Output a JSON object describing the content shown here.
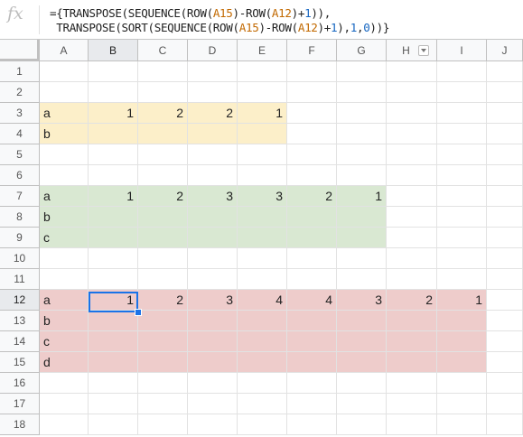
{
  "formula_bar": {
    "fx_label": "fx",
    "line1": [
      {
        "t": "={TRANSPOSE(SEQUENCE(ROW(",
        "c": "txt"
      },
      {
        "t": "A15",
        "c": "ref"
      },
      {
        "t": ")-ROW(",
        "c": "txt"
      },
      {
        "t": "A12",
        "c": "ref"
      },
      {
        "t": ")+",
        "c": "txt"
      },
      {
        "t": "1",
        "c": "num"
      },
      {
        "t": ")),",
        "c": "txt"
      }
    ],
    "line2": [
      {
        "t": " TRANSPOSE(SORT(SEQUENCE(ROW(",
        "c": "txt"
      },
      {
        "t": "A15",
        "c": "ref"
      },
      {
        "t": ")-ROW(",
        "c": "txt"
      },
      {
        "t": "A12",
        "c": "ref"
      },
      {
        "t": ")+",
        "c": "txt"
      },
      {
        "t": "1",
        "c": "num"
      },
      {
        "t": "),",
        "c": "txt"
      },
      {
        "t": "1",
        "c": "num"
      },
      {
        "t": ",",
        "c": "txt"
      },
      {
        "t": "0",
        "c": "num"
      },
      {
        "t": "))}",
        "c": "txt"
      }
    ]
  },
  "columns": [
    "A",
    "B",
    "C",
    "D",
    "E",
    "F",
    "G",
    "H",
    "I",
    "J"
  ],
  "rows": [
    "1",
    "2",
    "3",
    "4",
    "5",
    "6",
    "7",
    "8",
    "9",
    "10",
    "11",
    "12",
    "13",
    "14",
    "15",
    "16",
    "17",
    "18"
  ],
  "selected": {
    "column": "B",
    "row": "12"
  },
  "filter_column": "H",
  "fills": {
    "yellow": "#fcefc9",
    "green": "#d9e8d2",
    "red": "#eecccb"
  },
  "cells": {
    "A3": "a",
    "B3": "1",
    "C3": "2",
    "D3": "2",
    "E3": "1",
    "A4": "b",
    "A7": "a",
    "B7": "1",
    "C7": "2",
    "D7": "3",
    "E7": "3",
    "F7": "2",
    "G7": "1",
    "A8": "b",
    "A9": "c",
    "A12": "a",
    "B12": "1",
    "C12": "2",
    "D12": "3",
    "E12": "4",
    "F12": "4",
    "G12": "3",
    "H12": "2",
    "I12": "1",
    "A13": "b",
    "A14": "c",
    "A15": "d"
  }
}
